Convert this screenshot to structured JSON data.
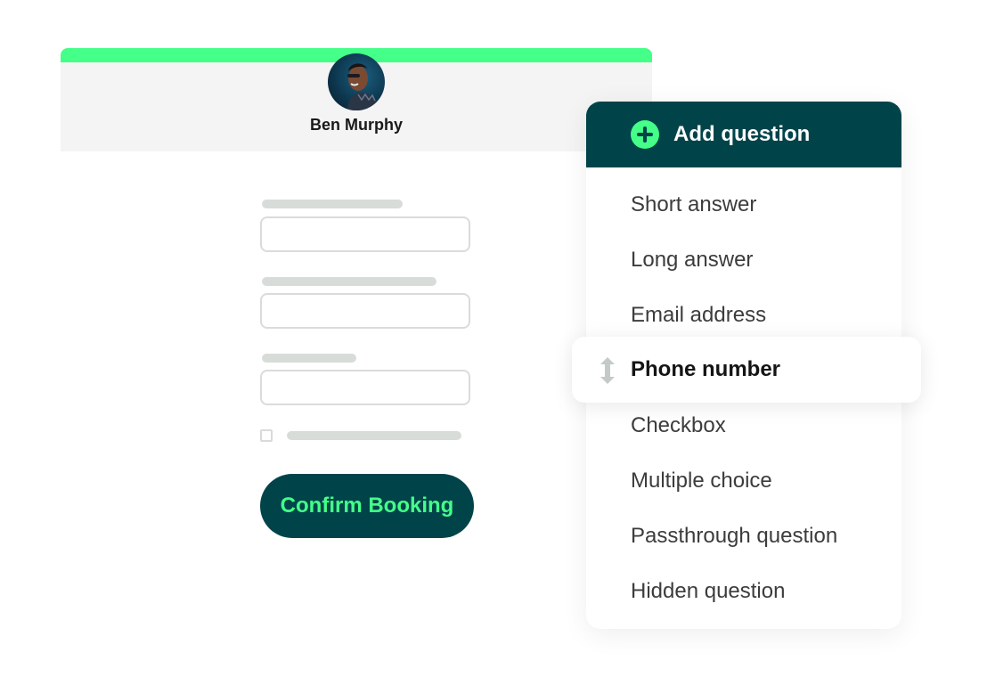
{
  "booking_form": {
    "host_name": "Ben Murphy",
    "avatar_alt": "host-avatar-photo",
    "confirm_button_label": "Confirm Booking",
    "accent_color": "#44ff88",
    "brand_dark": "#00444a"
  },
  "question_menu": {
    "title": "Add question",
    "icon": "plus-circle-icon",
    "items": [
      {
        "label": "Short answer"
      },
      {
        "label": "Long answer"
      },
      {
        "label": "Email address"
      },
      {
        "label": "Phone number",
        "dragging": true,
        "icon": "drag-vertical-icon"
      },
      {
        "label": "Checkbox"
      },
      {
        "label": "Multiple choice"
      },
      {
        "label": "Passthrough question"
      },
      {
        "label": "Hidden question"
      }
    ]
  }
}
